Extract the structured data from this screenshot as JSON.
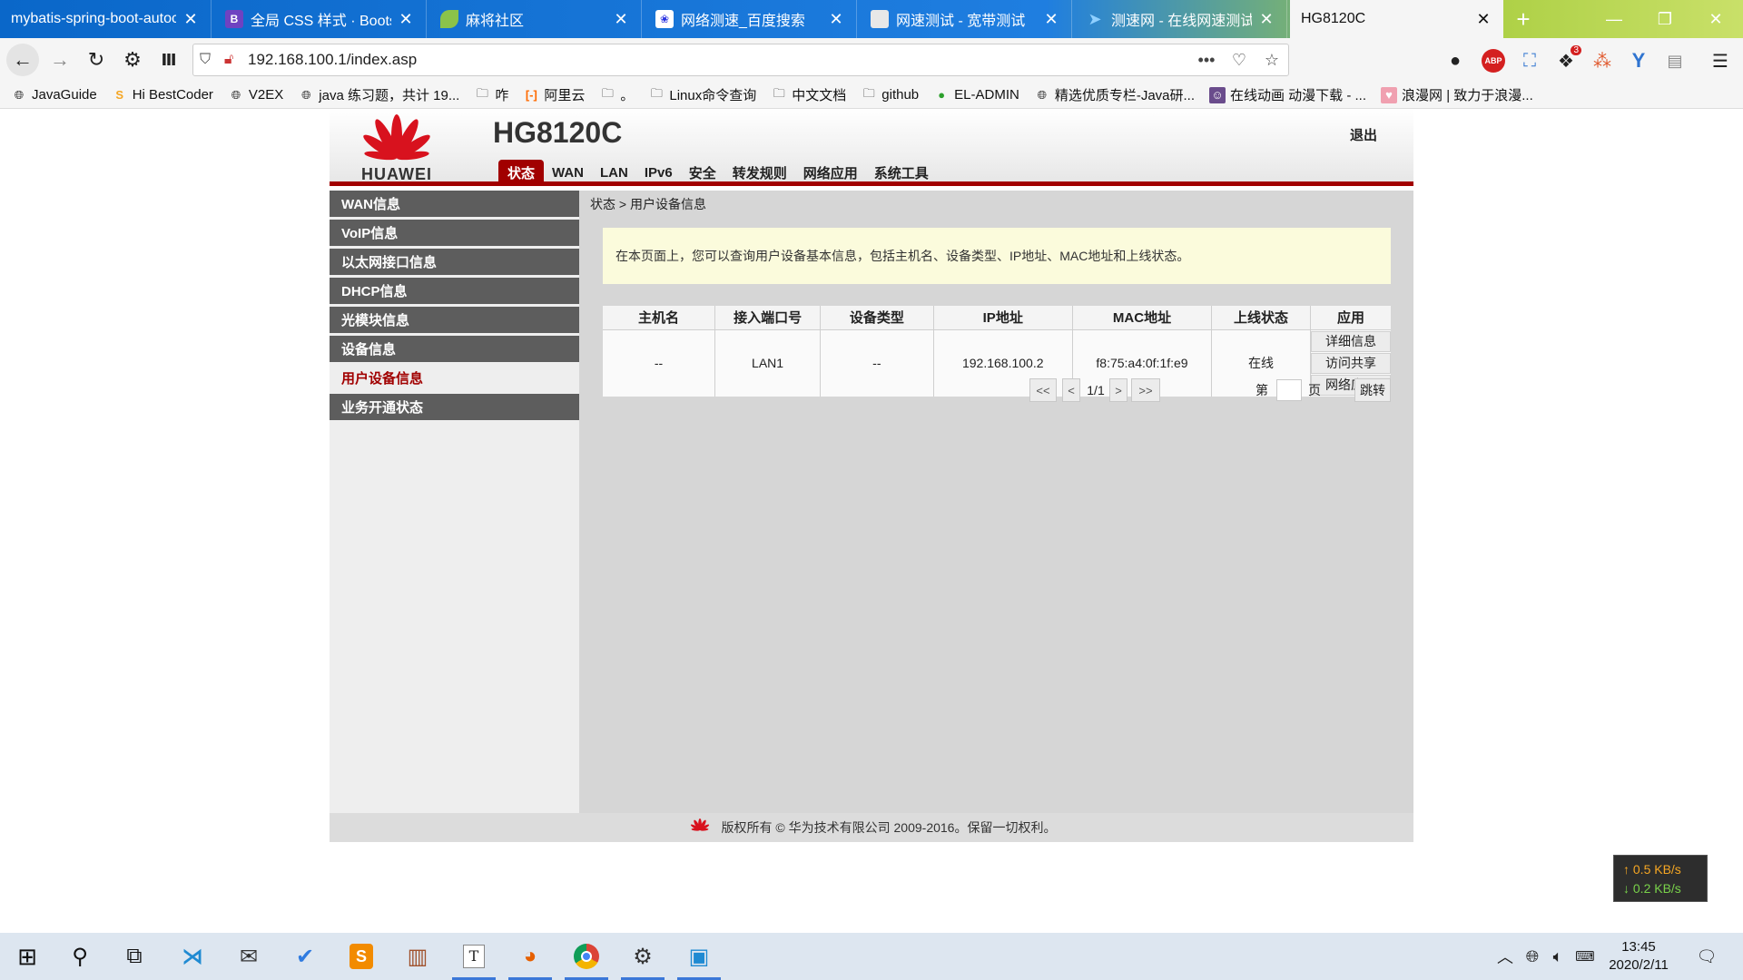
{
  "browser": {
    "tabs": [
      {
        "title": "mybatis-spring-boot-autoc",
        "favicon": "page-icon",
        "active": false
      },
      {
        "title": "全局 CSS 样式 · Bootstr",
        "favicon": "bootstrap-icon",
        "active": false
      },
      {
        "title": "麻将社区",
        "favicon": "leaf-icon",
        "active": false
      },
      {
        "title": "网络测速_百度搜索",
        "favicon": "baidu-icon",
        "active": false
      },
      {
        "title": "网速测试 - 宽带测试",
        "favicon": "page-icon",
        "active": false
      },
      {
        "title": "测速网 - 在线网速测试,",
        "favicon": "speedtest-icon",
        "active": false
      },
      {
        "title": "HG8120C",
        "favicon": "",
        "active": true
      }
    ],
    "theme_watermark": "Lucky Bamboo",
    "url": "192.168.100.1/index.asp",
    "bookmarks": [
      {
        "label": "JavaGuide",
        "icon": "globe-icon"
      },
      {
        "label": "Hi BestCoder",
        "icon": "bestcoder-icon"
      },
      {
        "label": "V2EX",
        "icon": "globe-icon"
      },
      {
        "label": "java 练习题，共计 19...",
        "icon": "globe-icon"
      },
      {
        "label": "咋",
        "icon": "folder-icon"
      },
      {
        "label": "阿里云",
        "icon": "aliyun-icon"
      },
      {
        "label": "。",
        "icon": "folder-icon"
      },
      {
        "label": "Linux命令查询",
        "icon": "folder-icon"
      },
      {
        "label": "中文文档",
        "icon": "folder-icon"
      },
      {
        "label": "github",
        "icon": "folder-icon"
      },
      {
        "label": "EL-ADMIN",
        "icon": "eladmin-icon"
      },
      {
        "label": "精选优质专栏-Java研...",
        "icon": "globe-icon"
      },
      {
        "label": "在线动画 动漫下载 - ...",
        "icon": "anime-icon"
      },
      {
        "label": "浪漫网 | 致力于浪漫...",
        "icon": "heart-icon"
      }
    ],
    "extension_badge": "3",
    "abp_label": "ABP"
  },
  "router": {
    "brand": "HUAWEI",
    "model": "HG8120C",
    "logout": "退出",
    "nav": [
      "状态",
      "WAN",
      "LAN",
      "IPv6",
      "安全",
      "转发规则",
      "网络应用",
      "系统工具"
    ],
    "active_nav": "状态",
    "sidebar": [
      "WAN信息",
      "VoIP信息",
      "以太网接口信息",
      "DHCP信息",
      "光模块信息",
      "设备信息",
      "用户设备信息",
      "业务开通状态"
    ],
    "active_sidebar": "用户设备信息",
    "breadcrumb": "状态 > 用户设备信息",
    "notice": "在本页面上，您可以查询用户设备基本信息，包括主机名、设备类型、IP地址、MAC地址和上线状态。",
    "table": {
      "headers": [
        "主机名",
        "接入端口号",
        "设备类型",
        "IP地址",
        "MAC地址",
        "上线状态",
        "应用"
      ],
      "rows": [
        {
          "host": "--",
          "port": "LAN1",
          "type": "--",
          "ip": "192.168.100.2",
          "mac": "f8:75:a4:0f:1f:e9",
          "status": "在线",
          "actions": [
            "详细信息",
            "访问共享",
            "网络应用"
          ]
        }
      ]
    },
    "pager": {
      "first": "<<",
      "prev": "<",
      "current": "1/1",
      "next": ">",
      "last": ">>",
      "page_prefix": "第",
      "page_suffix": "页",
      "jump": "跳转"
    },
    "footer": "版权所有 © 华为技术有限公司 2009-2016。保留一切权利。",
    "brand_color": "#a10000"
  },
  "netspeed": {
    "up": "↑ 0.5 KB/s",
    "down": "↓ 0.2 KB/s"
  },
  "taskbar": {
    "time": "13:45",
    "date": "2020/2/11"
  }
}
